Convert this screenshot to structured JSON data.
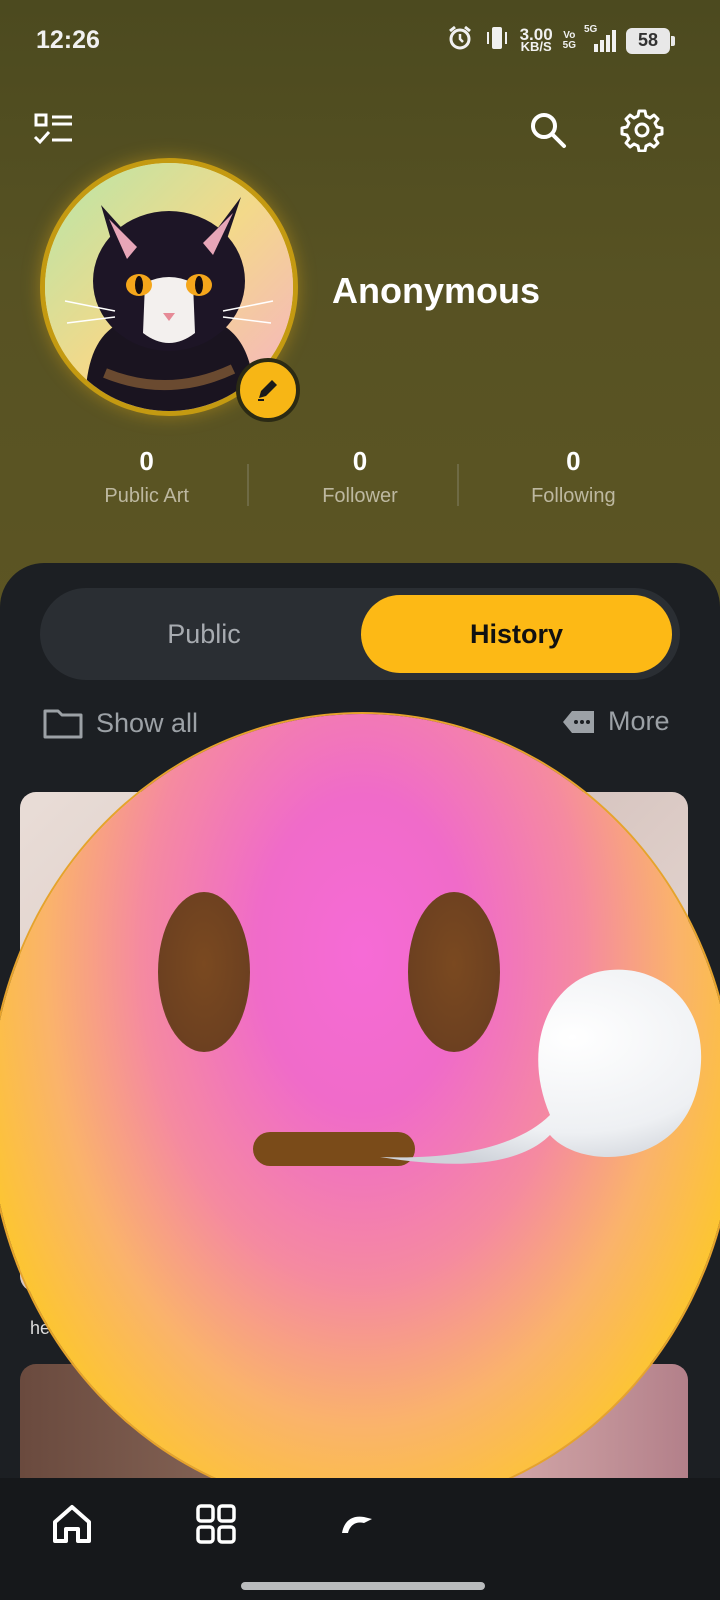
{
  "status_bar": {
    "time": "12:26",
    "net_speed_value": "3.00",
    "net_speed_unit": "KB/S",
    "vo_label": "Vo",
    "vo_sub": "5G",
    "signal_label": "5G",
    "battery": "58"
  },
  "profile": {
    "username": "Anonymous",
    "stats": [
      {
        "value": "0",
        "label": "Public Art"
      },
      {
        "value": "0",
        "label": "Follower"
      },
      {
        "value": "0",
        "label": "Following"
      }
    ]
  },
  "tabs": {
    "public_label": "Public",
    "history_label": "History",
    "selected": "History"
  },
  "filter_row": {
    "show_all_label": "Show all",
    "more_label": "More"
  },
  "content": {
    "thumb_caption": "he"
  },
  "colors": {
    "accent": "#fdb915",
    "sheet_bg": "#1c1f23",
    "header_bg": "#575223"
  },
  "icons": {
    "top_left": "checklist-icon",
    "search": "search-icon",
    "settings": "gear-icon",
    "edit": "pencil-icon",
    "folder": "folder-icon",
    "more": "more-tag-icon",
    "nav": [
      "home-icon",
      "grid-icon",
      "create-icon"
    ]
  }
}
